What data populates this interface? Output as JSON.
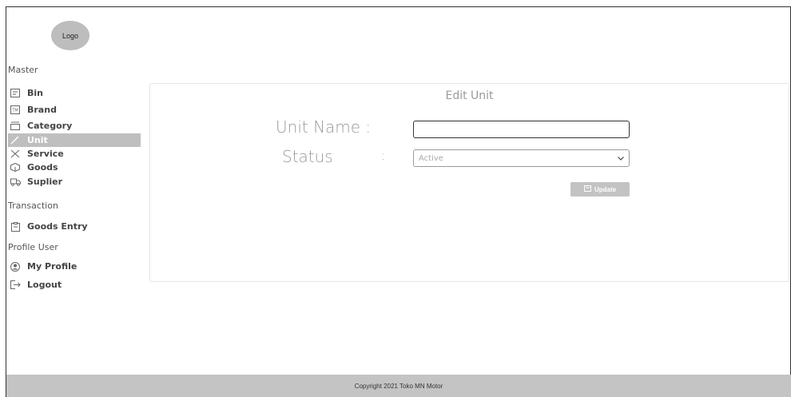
{
  "logo": {
    "text": "Logo"
  },
  "sidebar": {
    "sections": [
      {
        "title": "Master",
        "items": [
          {
            "label": "Bin",
            "icon": "list-icon"
          },
          {
            "label": "Brand",
            "icon": "trademark-icon"
          },
          {
            "label": "Category",
            "icon": "category-icon"
          },
          {
            "label": "Unit",
            "icon": "pencil-icon",
            "active": true
          },
          {
            "label": "Service",
            "icon": "tools-icon"
          },
          {
            "label": "Goods",
            "icon": "box-icon"
          },
          {
            "label": "Suplier",
            "icon": "truck-icon"
          }
        ]
      },
      {
        "title": "Transaction",
        "items": [
          {
            "label": "Goods Entry",
            "icon": "clipboard-icon"
          }
        ]
      },
      {
        "title": "Profile User",
        "items": [
          {
            "label": "My Profile",
            "icon": "user-circle-icon"
          },
          {
            "label": "Logout",
            "icon": "logout-icon"
          }
        ]
      }
    ]
  },
  "form": {
    "title": "Edit Unit",
    "unit_name_label": "Unit Name :",
    "unit_name_value": "",
    "status_label": "Status",
    "status_colon": ":",
    "status_selected": "Active",
    "update_label": "Update"
  },
  "footer": {
    "text": "Copyright 2021 Toko MN Motor"
  },
  "colors": {
    "active_bg": "#bfbfbf",
    "footer_bg": "#c4c4c4",
    "button_bg": "#c3c3c3"
  }
}
